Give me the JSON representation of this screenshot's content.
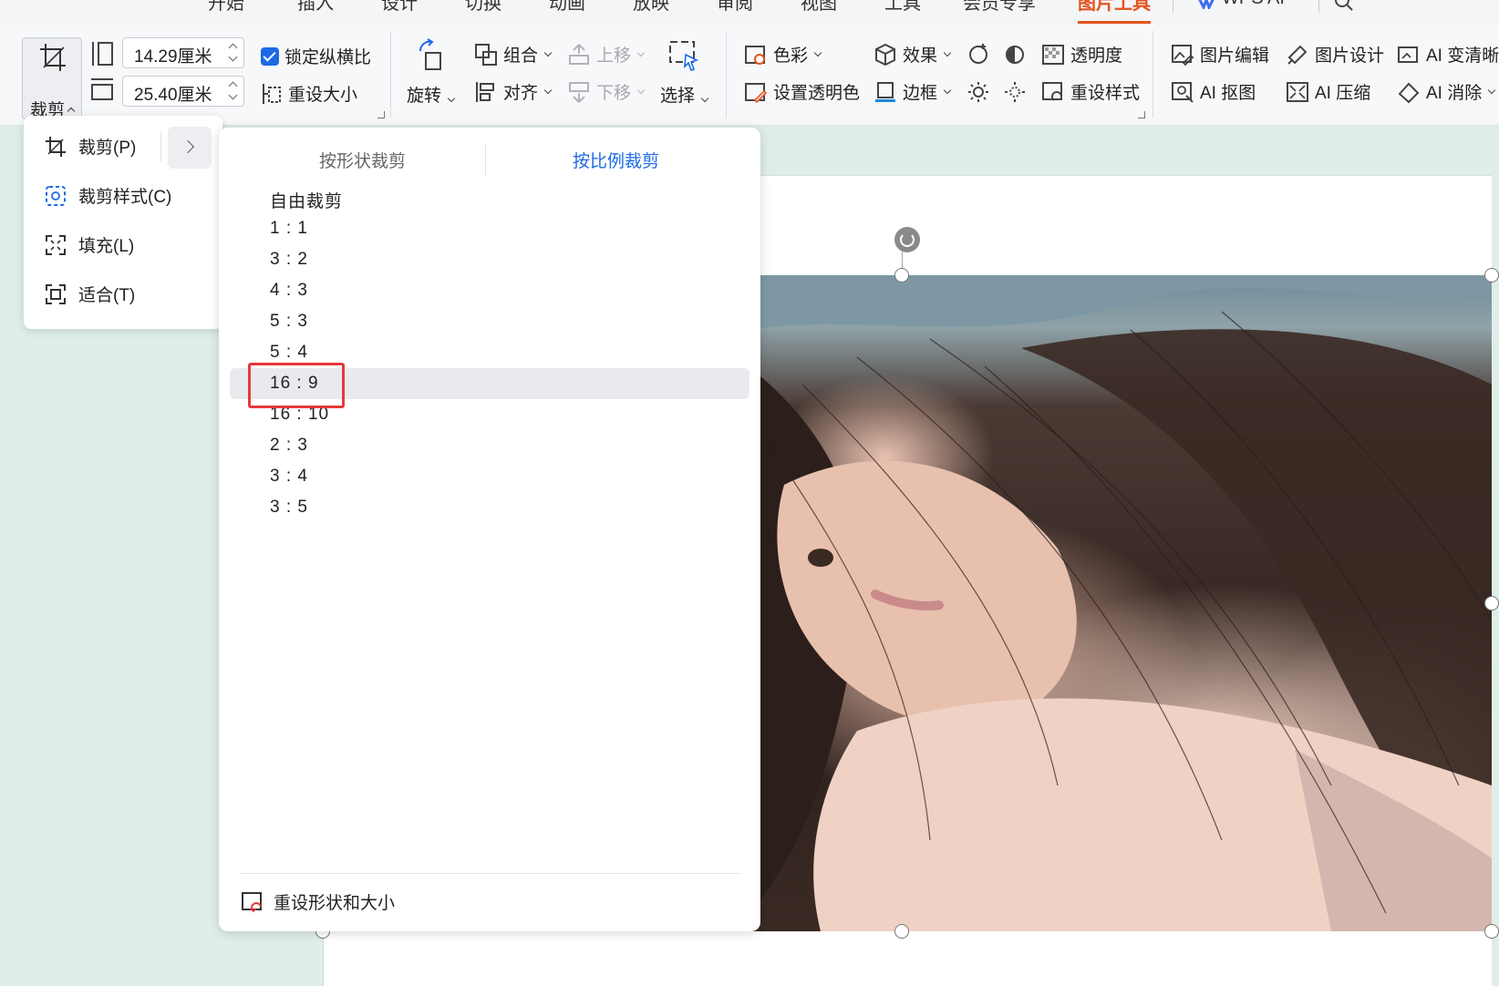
{
  "tabs": [
    {
      "label": "开始"
    },
    {
      "label": "插入"
    },
    {
      "label": "设计"
    },
    {
      "label": "切换"
    },
    {
      "label": "动画"
    },
    {
      "label": "放映"
    },
    {
      "label": "审阅"
    },
    {
      "label": "视图"
    },
    {
      "label": "工具"
    },
    {
      "label": "会员专享"
    },
    {
      "label": "图片工具",
      "active": true
    },
    {
      "label": "WPS AI"
    }
  ],
  "ribbon": {
    "crop_label": "裁剪",
    "height_value": "14.29厘米",
    "width_value": "25.40厘米",
    "lock_ratio": "锁定纵横比",
    "reset_size": "重设大小",
    "rotate": "旋转",
    "group": "组合",
    "align": "对齐",
    "move_up": "上移",
    "move_down": "下移",
    "select": "选择",
    "color": "色彩",
    "set_transparent": "设置透明色",
    "effect": "效果",
    "border": "边框",
    "transparency": "透明度",
    "reset_style": "重设样式",
    "picture_edit": "图片编辑",
    "picture_design": "图片设计",
    "ai_sharpen": "AI 变清晰",
    "ai_cutout": "AI 抠图",
    "ai_compress": "AI 压缩",
    "ai_erase": "AI 消除"
  },
  "crop_menu": {
    "items": [
      {
        "label": "裁剪(P)"
      },
      {
        "label": "裁剪样式(C)"
      },
      {
        "label": "填充(L)"
      },
      {
        "label": "适合(T)"
      }
    ]
  },
  "ratio_menu": {
    "tab_shape": "按形状裁剪",
    "tab_ratio": "按比例裁剪",
    "items": [
      "自由裁剪",
      "1 : 1",
      "3 : 2",
      "4 : 3",
      "5 : 3",
      "5 : 4",
      "16 : 9",
      "16 : 10",
      "2 : 3",
      "3 : 4",
      "3 : 5"
    ],
    "hovered_index": 6,
    "reset_label": "重设形状和大小"
  },
  "colors": {
    "accent": "#e2531e",
    "link_blue": "#1d6ae5",
    "highlight_red": "#e8383b"
  }
}
